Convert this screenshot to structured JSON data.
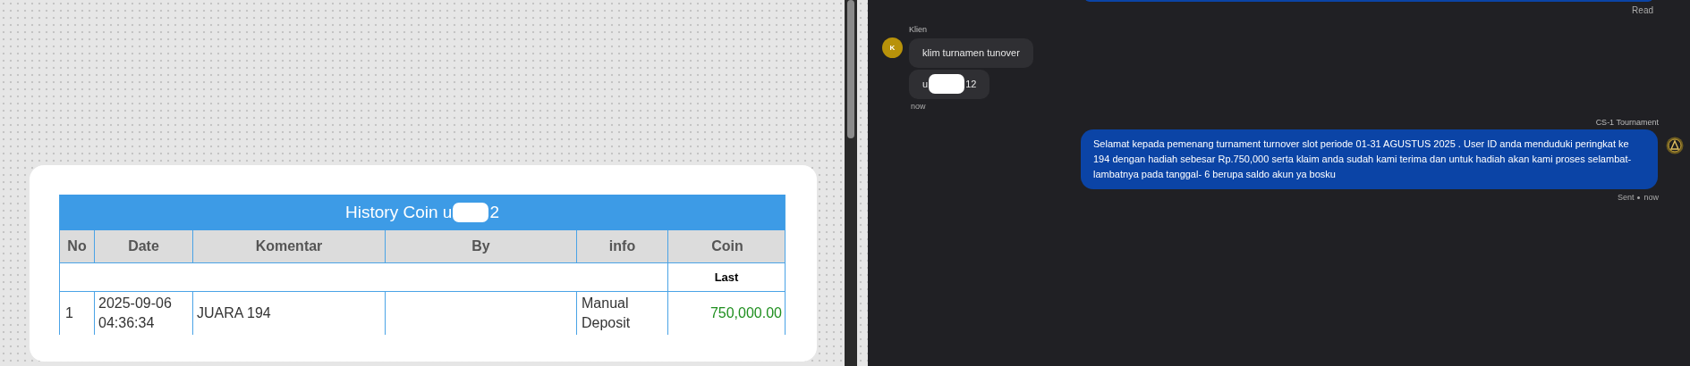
{
  "history_card": {
    "title_prefix": "History Coin u",
    "title_suffix": "2",
    "columns": [
      "No",
      "Date",
      "Komentar",
      "By",
      "info",
      "Coin"
    ],
    "summary_row": {
      "coin": "Last"
    },
    "rows": [
      {
        "no": "1",
        "date": "2025-09-06 04:36:34",
        "komentar": "JUARA 194",
        "by": "",
        "info": "Manual Deposit",
        "coin": "750,000.00"
      }
    ]
  },
  "chat": {
    "previous_status": "Read",
    "incoming": {
      "sender": "Klien",
      "avatar_letter": "K",
      "messages": [
        {
          "parts": [
            "klim turnamen tunover"
          ]
        },
        {
          "parts": [
            "u",
            "12"
          ]
        }
      ],
      "time": "now"
    },
    "outgoing": {
      "sender": "CS-1 Tournament",
      "text": "Selamat kepada pemenang turnament turnover slot periode 01-31 AGUSTUS 2025 . User ID anda menduduki peringkat ke 194 dengan hadiah sebesar Rp.750,000 serta klaim anda sudah kami terima dan untuk hadiah akan kami proses selambat-lambatnya pada tanggal- 6 berupa saldo akun ya bosku",
      "status": "Sent",
      "time": "now"
    }
  }
}
